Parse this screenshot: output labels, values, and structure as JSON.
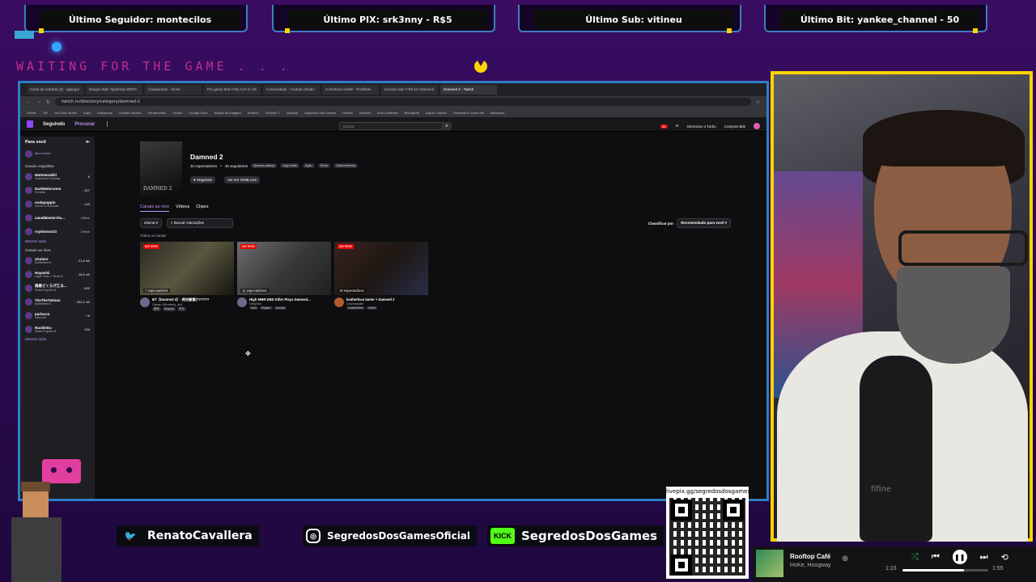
{
  "overlay": {
    "banners": [
      {
        "label": "Último Seguidor: montecilos"
      },
      {
        "label": "Último PIX: srk3nny - R$5"
      },
      {
        "label": "Último Sub: vitineu"
      },
      {
        "label": "Último Bit: yankee_channel - 50"
      }
    ],
    "waiting_text": "WAITING FOR THE GAME . . .",
    "accent_color": "#ffd400",
    "frame_color": "#2d7fc3"
  },
  "browser": {
    "tabs": [
      "Caixa de entrada (3) - agsegre",
      "Dragon Ball: Sparking! ZERO",
      "Campanhas - drone",
      "Pro game that CHILALO in Vhi",
      "Comunidade - Youtube Studio",
      "Cobertura Health - Planilhas",
      "Iconsxt rodo T-Rd em Damned",
      "Damned 2 - Twitch"
    ],
    "address": "twitch.tv/directory/category/damned-2",
    "bookmarks": [
      "GMAIL",
      "SS",
      "YouTube Studio",
      "Kapa",
      "Infosecure",
      "Granite Studios",
      "Ferramentas",
      "Outros",
      "Google Drive",
      "Edição de imagem",
      "Anterior",
      "Thumbs T",
      "Notícias",
      "Segredos dos Games",
      "Humbe",
      "Nuvibes",
      "Ilícito Defense",
      "BloodBath",
      "Arquiv. Ranker",
      "Encontre lo zoom ide",
      "Marcados"
    ]
  },
  "twitch": {
    "nav": {
      "following": "Seguindo",
      "browse": "Procurar",
      "more": "⋮"
    },
    "search_placeholder": "Buscar",
    "right": {
      "turbo": "Gerenciar o Turbo",
      "bits": "Comprar Bits",
      "notif_count": "33"
    },
    "sidebar": {
      "header": "Para você",
      "user_hint": "Alert sceller",
      "followed_title": "Canais seguidos",
      "followed": [
        {
          "name": "Mattewsukhi",
          "game": "Grantham Fantasy",
          "count": "8"
        },
        {
          "name": "DarkMelocoton",
          "game": "Fortnite",
          "count": "207"
        },
        {
          "name": "sodapoppin",
          "game": "World of Warcraft",
          "count": "143"
        },
        {
          "name": "canalMasterAlu...",
          "game": "",
          "count": "Offline"
        },
        {
          "name": "roydomon23",
          "game": "",
          "count": "Offline"
        }
      ],
      "show_more_1": "Mostrar mais",
      "live_title": "Canais ao vivo",
      "live": [
        {
          "name": "zGuiere",
          "game": "Battlefield 6",
          "count": "21,6 mil"
        },
        {
          "name": "Hayashii",
          "game": "Hype Train + Nível 8",
          "count": "15,5 mil"
        },
        {
          "name": "偽善どくらげ乙る...",
          "game": "Street Fighter 6",
          "count": "820"
        },
        {
          "name": "TimTheTatman",
          "game": "Battlefield 6",
          "count": "202,2 mil"
        },
        {
          "name": "parlacco",
          "game": "Valorant",
          "count": "76"
        },
        {
          "name": "NuckleDu",
          "game": "Street Fighter 6",
          "count": "134"
        }
      ],
      "show_more_2": "Mostrar mais"
    },
    "game": {
      "title": "Damned 2",
      "cover_text": "DAMNED 2",
      "viewers": "32 espectadores",
      "followers": "30 seguidores",
      "tags": [
        "Quebra-cabeça",
        "Jogo Indie",
        "Ação",
        "Terror",
        "Sobrevivência"
      ],
      "follow_label": "Seguindo",
      "igdb_label": "Ver em IGDB.com"
    },
    "subtabs": [
      "Canais ao vivo",
      "Vídeos",
      "Clipes"
    ],
    "filters": {
      "language": "Idioma",
      "search_tags": "Buscar marcações"
    },
    "sort": {
      "label": "Classificar por",
      "value": "Recomendado para você"
    },
    "all_channels": "Todos os canais",
    "cards": [
      {
        "live": "AO VIVO",
        "viewers": "7 espectadores",
        "title": "8/7【Damned 2】- 爬先驗實(??????",
        "channel": "Ojisan (Kimberly_lei)",
        "tags": [
          "精彩",
          "Singing",
          "中文"
        ]
      },
      {
        "live": "AO VIVO",
        "viewers": "11 espectadores",
        "title": "High MMR DBD Killer Plays Damned...",
        "channel": "OnlyDez",
        "tags": [
          "Solo",
          "English",
          "Spooky"
        ]
      },
      {
        "live": "AO VIVO",
        "viewers": "18 espectadores",
        "title": "leatherface tamer + Damned 2",
        "channel": "Chunsnyder",
        "tags": [
          "Leatherface",
          "Horror"
        ]
      }
    ]
  },
  "socials": [
    {
      "icon": "twitter-icon",
      "handle": "RenatoCavallera"
    },
    {
      "icon": "instagram-icon",
      "handle": "SegredosDosGamesOficial"
    },
    {
      "icon": "kick-icon",
      "badge": "KICK",
      "handle": "SegredosDosGames"
    }
  ],
  "qr": {
    "label": "livepix.gg/segredosdosgames"
  },
  "webcam": {
    "mic_brand": "fifine"
  },
  "player": {
    "song": "Rooftop Café",
    "artist": "HoKe, Hoogway",
    "current": "1:23",
    "duration": "1:55",
    "progress_fraction": 0.72
  }
}
